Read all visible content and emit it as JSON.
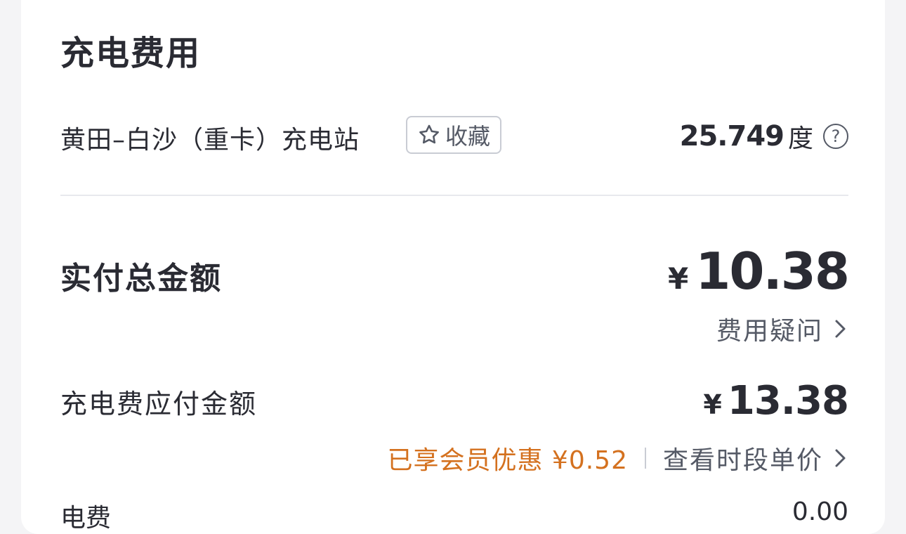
{
  "section": {
    "title": "充电费用"
  },
  "station": {
    "name": "黄田–白沙（重卡）充电站",
    "favorite_label": "收藏",
    "energy_value": "25.749",
    "energy_unit": "度",
    "help_icon": "question-circle-icon"
  },
  "total": {
    "label": "实付总金额",
    "currency": "¥",
    "amount": "10.38",
    "fee_question_label": "费用疑问"
  },
  "payable": {
    "label": "充电费应付金额",
    "currency": "¥",
    "amount": "13.38",
    "discount_text": "已享会员优惠 ¥0.52",
    "period_price_label": "查看时段单价"
  },
  "next_row": {
    "label_partial": "电费",
    "value_partial": "0.00"
  },
  "colors": {
    "text_primary": "#2a2b33",
    "text_secondary": "#555a66",
    "discount_orange": "#d4711f",
    "divider": "#e8e9ed",
    "page_background": "#f4f4f6",
    "card_background": "#ffffff"
  }
}
